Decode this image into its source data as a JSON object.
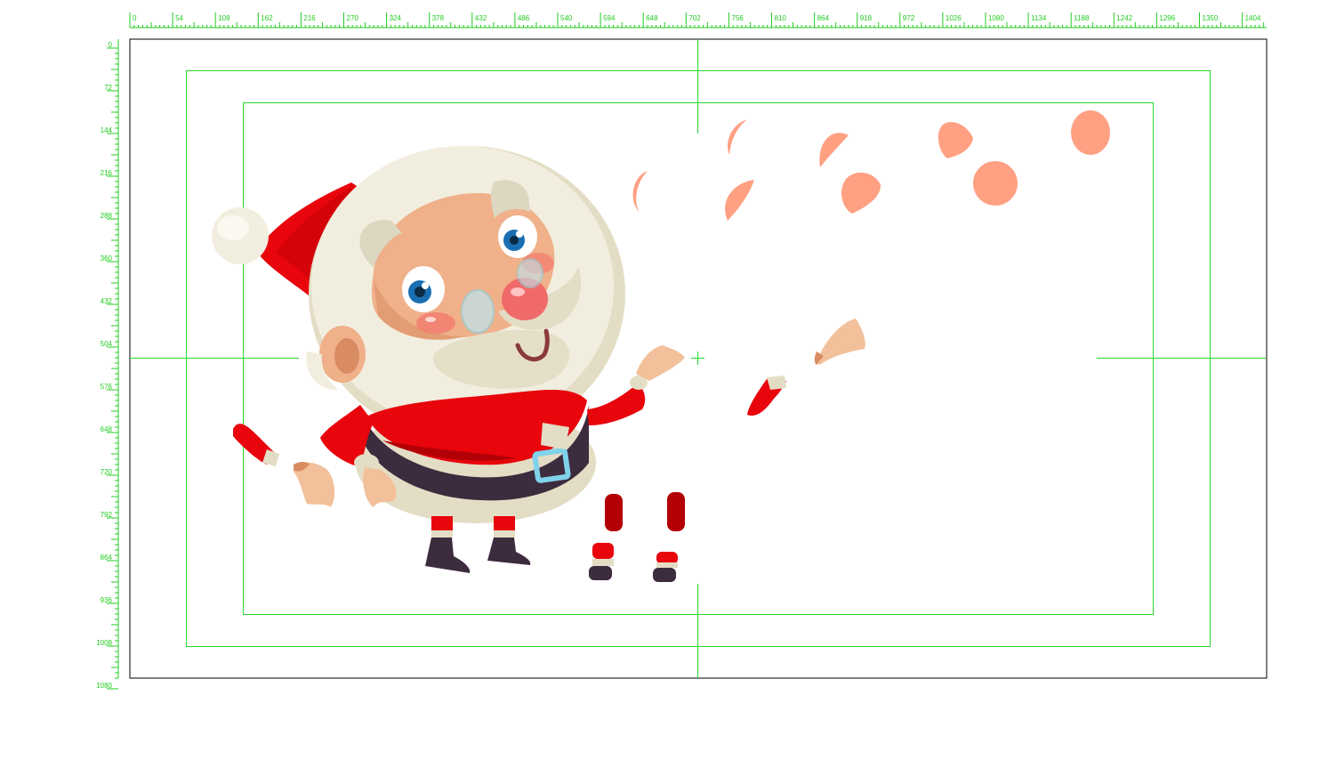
{
  "rulers": {
    "top_labels": [
      "0",
      "54",
      "108",
      "162",
      "216",
      "270",
      "324",
      "378",
      "432",
      "486",
      "540",
      "594",
      "648",
      "702",
      "756",
      "810",
      "864",
      "918",
      "972",
      "1026",
      "1080",
      "1134",
      "1188",
      "1242",
      "1296",
      "1350",
      "1404"
    ],
    "left_labels": [
      "0",
      "72",
      "144",
      "216",
      "288",
      "360",
      "432",
      "504",
      "576",
      "648",
      "720",
      "792",
      "864",
      "936",
      "1008",
      "1080"
    ]
  },
  "colors": {
    "guide": "#2bd62b",
    "ruler": "#22cc22",
    "canvas_border": "#000000",
    "coat_red": "#e8050c",
    "coat_dark_red": "#b30006",
    "fur": "#f2eedf",
    "fur_shadow": "#d9d3bd",
    "skin": "#efb08a",
    "skin_dark": "#d98c62",
    "cheek": "#f37a6e",
    "particle": "#ffa083",
    "belt": "#3d2b3e",
    "buckle": "#7fd2ea",
    "boot": "#3d2b3e",
    "eye_blue": "#1a6fb3"
  },
  "scene": {
    "subject": "santa-character-sprite-sheet",
    "particle_count": 10
  }
}
